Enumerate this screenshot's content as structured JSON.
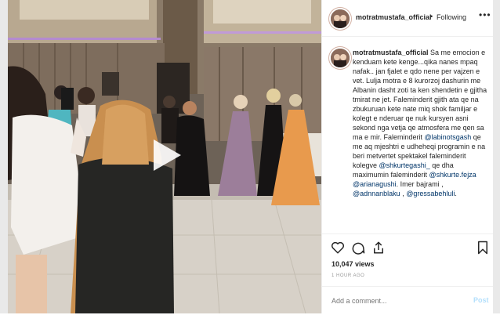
{
  "header": {
    "username": "motratmustafa_official",
    "separator": "•",
    "follow_label": "Following",
    "more_icon": "more-options-icon"
  },
  "caption": {
    "username": "motratmustafa_official",
    "parts": [
      {
        "t": "Sa me emocion e kenduam kete kenge...qika nanes mpaq nafak.. jan fjalet e qdo nene per vajzen e vet. Lulja motra e 8 kurorzoj dashurin me Albanin dasht zoti ta ken shendetin e gjitha tmirat ne jet. Faleminderit gjith ata qe na zbukuruan kete nate miq shok familjar e kolegt e nderuar qe nuk kursyen asni sekond nga vetja qe atmosfera me qen sa ma e mir. Faleminderit ",
        "m": false
      },
      {
        "t": "@labinotsgash",
        "m": true
      },
      {
        "t": " qe me aq mjeshtri e udheheqi programin e na beri metvertet spektakel faleminderit kolegve ",
        "m": false
      },
      {
        "t": "@shkurtegashi_",
        "m": true
      },
      {
        "t": " qe dha maximumin faleminderit ",
        "m": false
      },
      {
        "t": "@shkurte.fejza",
        "m": true
      },
      {
        "t": " ",
        "m": false
      },
      {
        "t": "@arianagushi",
        "m": true
      },
      {
        "t": ". Imer bajrami , ",
        "m": false
      },
      {
        "t": "@adnnanblaku",
        "m": true
      },
      {
        "t": " , ",
        "m": false
      },
      {
        "t": "@gressabehluli",
        "m": true
      },
      {
        "t": ".",
        "m": false
      }
    ]
  },
  "actions": {
    "icons": [
      "heart-icon",
      "comment-icon",
      "share-icon",
      "bookmark-icon"
    ],
    "views": "10,047 views",
    "time": "1 HOUR AGO"
  },
  "comment": {
    "placeholder": "Add a comment...",
    "post_label": "Post"
  },
  "media": {
    "play_icon": "play-icon",
    "accent": "#0095f6"
  }
}
